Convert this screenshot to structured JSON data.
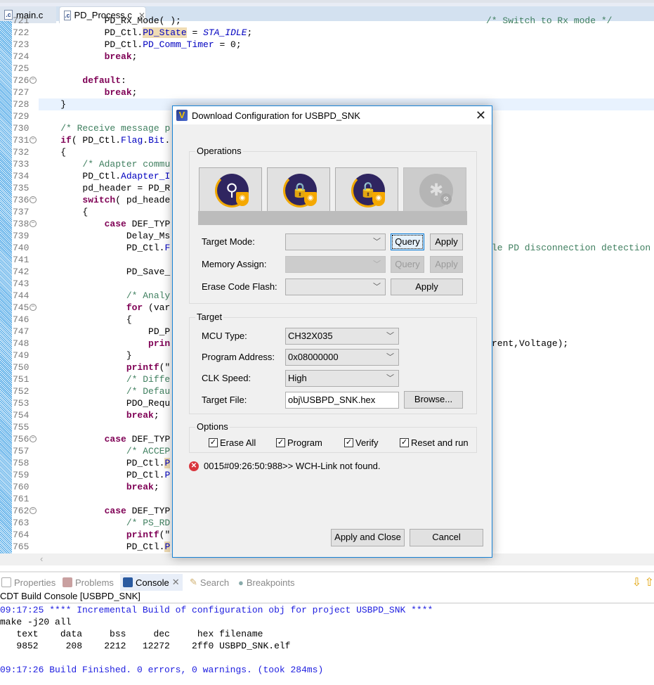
{
  "editor": {
    "tabs": [
      {
        "label": "main.c",
        "icon": "c-file-icon"
      },
      {
        "label": "PD_Process.c",
        "icon": "c-file-icon",
        "active": true
      }
    ],
    "lines": [
      {
        "n": "721",
        "seg": [
          [
            "            ",
            "p"
          ],
          [
            "PD_Rx_Mode( );",
            "p"
          ]
        ],
        "right": "/* Switch to Rx mode */"
      },
      {
        "n": "722",
        "seg": [
          [
            "            PD_Ctl.",
            "p"
          ],
          [
            "PD_State",
            "fm"
          ],
          [
            " = ",
            "p"
          ],
          [
            "STA_IDLE",
            "i"
          ],
          [
            ";",
            "p"
          ]
        ]
      },
      {
        "n": "723",
        "seg": [
          [
            "            PD_Ctl.",
            "p"
          ],
          [
            "PD_Comm_Timer",
            "f"
          ],
          [
            " = 0;",
            "p"
          ]
        ]
      },
      {
        "n": "724",
        "seg": [
          [
            "            ",
            "p"
          ],
          [
            "break",
            "k"
          ],
          [
            ";",
            "p"
          ]
        ]
      },
      {
        "n": "725",
        "seg": []
      },
      {
        "n": "726",
        "fold": true,
        "seg": [
          [
            "        ",
            "p"
          ],
          [
            "default",
            "k"
          ],
          [
            ":",
            "p"
          ]
        ]
      },
      {
        "n": "727",
        "seg": [
          [
            "            ",
            "p"
          ],
          [
            "break",
            "k"
          ],
          [
            ";",
            "p"
          ]
        ]
      },
      {
        "n": "728",
        "hl": true,
        "seg": [
          [
            "    }",
            "p"
          ]
        ]
      },
      {
        "n": "729",
        "seg": []
      },
      {
        "n": "730",
        "seg": [
          [
            "    ",
            "p"
          ],
          [
            "/* Receive message p",
            "c"
          ]
        ]
      },
      {
        "n": "731",
        "fold": true,
        "seg": [
          [
            "    ",
            "p"
          ],
          [
            "if",
            "k"
          ],
          [
            "( PD_Ctl.",
            "p"
          ],
          [
            "Flag",
            "f"
          ],
          [
            ".",
            "p"
          ],
          [
            "Bit",
            "f"
          ],
          [
            ".",
            "p"
          ]
        ]
      },
      {
        "n": "732",
        "seg": [
          [
            "    {",
            "p"
          ]
        ]
      },
      {
        "n": "733",
        "seg": [
          [
            "        ",
            "p"
          ],
          [
            "/* Adapter commu",
            "c"
          ]
        ]
      },
      {
        "n": "734",
        "seg": [
          [
            "        PD_Ctl.",
            "p"
          ],
          [
            "Adapter_I",
            "f"
          ]
        ]
      },
      {
        "n": "735",
        "seg": [
          [
            "        pd_header = PD_R",
            "p"
          ]
        ]
      },
      {
        "n": "736",
        "fold": true,
        "seg": [
          [
            "        ",
            "p"
          ],
          [
            "switch",
            "k"
          ],
          [
            "( pd_heade",
            "p"
          ]
        ]
      },
      {
        "n": "737",
        "seg": [
          [
            "        {",
            "p"
          ]
        ]
      },
      {
        "n": "738",
        "fold": true,
        "seg": [
          [
            "            ",
            "p"
          ],
          [
            "case",
            "k"
          ],
          [
            " DEF_TYP",
            "p"
          ]
        ]
      },
      {
        "n": "739",
        "seg": [
          [
            "                Delay_Ms",
            "p"
          ]
        ]
      },
      {
        "n": "740",
        "seg": [
          [
            "                PD_Ctl.",
            "p"
          ],
          [
            "F",
            "f"
          ]
        ],
        "right": "le PD disconnection detection"
      },
      {
        "n": "741",
        "seg": []
      },
      {
        "n": "742",
        "seg": [
          [
            "                PD_Save_",
            "p"
          ]
        ]
      },
      {
        "n": "743",
        "seg": []
      },
      {
        "n": "744",
        "seg": [
          [
            "                ",
            "p"
          ],
          [
            "/* Analy",
            "c"
          ]
        ]
      },
      {
        "n": "745",
        "fold": true,
        "seg": [
          [
            "                ",
            "p"
          ],
          [
            "for",
            "k"
          ],
          [
            " (var",
            "p"
          ]
        ]
      },
      {
        "n": "746",
        "seg": [
          [
            "                {",
            "p"
          ]
        ]
      },
      {
        "n": "747",
        "seg": [
          [
            "                    PD_P",
            "p"
          ]
        ]
      },
      {
        "n": "748",
        "seg": [
          [
            "                    ",
            "p"
          ],
          [
            "prin",
            "k"
          ]
        ],
        "right": "rent,Voltage);"
      },
      {
        "n": "749",
        "seg": [
          [
            "                }",
            "p"
          ]
        ]
      },
      {
        "n": "750",
        "seg": [
          [
            "                ",
            "p"
          ],
          [
            "printf",
            "k"
          ],
          [
            "(\"",
            "p"
          ]
        ]
      },
      {
        "n": "751",
        "seg": [
          [
            "                ",
            "p"
          ],
          [
            "/* Diffe",
            "c"
          ]
        ]
      },
      {
        "n": "752",
        "seg": [
          [
            "                ",
            "p"
          ],
          [
            "/* Defau",
            "c"
          ]
        ]
      },
      {
        "n": "753",
        "seg": [
          [
            "                PDO_Requ",
            "p"
          ]
        ]
      },
      {
        "n": "754",
        "seg": [
          [
            "                ",
            "p"
          ],
          [
            "break",
            "k"
          ],
          [
            ";",
            "p"
          ]
        ]
      },
      {
        "n": "755",
        "seg": []
      },
      {
        "n": "756",
        "fold": true,
        "seg": [
          [
            "            ",
            "p"
          ],
          [
            "case",
            "k"
          ],
          [
            " DEF_TYP",
            "p"
          ]
        ]
      },
      {
        "n": "757",
        "seg": [
          [
            "                ",
            "p"
          ],
          [
            "/* ACCEP",
            "c"
          ]
        ]
      },
      {
        "n": "758",
        "seg": [
          [
            "                PD_Ctl.",
            "p"
          ],
          [
            "P",
            "fm"
          ]
        ]
      },
      {
        "n": "759",
        "seg": [
          [
            "                PD_Ctl.",
            "p"
          ],
          [
            "P",
            "f"
          ]
        ]
      },
      {
        "n": "760",
        "seg": [
          [
            "                ",
            "p"
          ],
          [
            "break",
            "k"
          ],
          [
            ";",
            "p"
          ]
        ]
      },
      {
        "n": "761",
        "seg": []
      },
      {
        "n": "762",
        "fold": true,
        "seg": [
          [
            "            ",
            "p"
          ],
          [
            "case",
            "k"
          ],
          [
            " DEF_TYP",
            "p"
          ]
        ]
      },
      {
        "n": "763",
        "seg": [
          [
            "                ",
            "p"
          ],
          [
            "/* PS_RD",
            "c"
          ]
        ]
      },
      {
        "n": "764",
        "seg": [
          [
            "                ",
            "p"
          ],
          [
            "printf",
            "k"
          ],
          [
            "(\"",
            "p"
          ]
        ]
      },
      {
        "n": "765",
        "seg": [
          [
            "                PD_Ctl.",
            "p"
          ],
          [
            "P",
            "fm"
          ]
        ]
      }
    ]
  },
  "dialog": {
    "title": "Download Configuration for USBPD_SNK",
    "operations": {
      "label": "Operations",
      "buttons": [
        {
          "name": "query-button",
          "icon": "magnifier-shield-icon",
          "glyph": "⚲",
          "enabled": true
        },
        {
          "name": "protect-button",
          "icon": "lock-check-shield-icon",
          "glyph": "🔒",
          "enabled": true
        },
        {
          "name": "unprotect-button",
          "icon": "unlock-shield-icon",
          "glyph": "🔓",
          "enabled": true
        },
        {
          "name": "debug-disable-button",
          "icon": "bug-disabled-icon",
          "glyph": "✱",
          "enabled": false
        }
      ],
      "progress": 0,
      "target_mode_label": "Target Mode:",
      "target_mode_value": "",
      "memory_assign_label": "Memory Assign:",
      "memory_assign_value": "",
      "erase_label": "Erase Code Flash:",
      "erase_value": "",
      "query": "Query",
      "apply": "Apply"
    },
    "target": {
      "label": "Target",
      "mcu_label": "MCU Type:",
      "mcu_value": "CH32X035",
      "addr_label": "Program Address:",
      "addr_value": "0x08000000",
      "clk_label": "CLK Speed:",
      "clk_value": "High",
      "file_label": "Target File:",
      "file_value": "obj\\USBPD_SNK.hex",
      "browse": "Browse..."
    },
    "options": {
      "label": "Options",
      "items": [
        {
          "label": "Erase All",
          "checked": true
        },
        {
          "label": "Program",
          "checked": true
        },
        {
          "label": "Verify",
          "checked": true
        },
        {
          "label": "Reset and run",
          "checked": true
        }
      ]
    },
    "status": "0015#09:26:50:988>> WCH-Link not found.",
    "apply_close": "Apply and Close",
    "cancel": "Cancel"
  },
  "views": {
    "tabs": [
      {
        "label": "Properties",
        "icon": "properties-icon"
      },
      {
        "label": "Problems",
        "icon": "problems-icon"
      },
      {
        "label": "Console",
        "icon": "console-icon",
        "active": true
      },
      {
        "label": "Search",
        "icon": "search-icon"
      },
      {
        "label": "Breakpoints",
        "icon": "breakpoints-icon"
      }
    ],
    "console_title": "CDT Build Console [USBPD_SNK]",
    "console_lines": [
      "09:17:25 **** Incremental Build of configuration obj for project USBPD_SNK ****",
      "make -j20 all",
      "   text\t   data\t    bss\t    dec\t    hex\tfilename",
      "   9852\t    208\t   2212\t  12272\t   2ff0\tUSBPD_SNK.elf",
      "",
      "09:17:26 Build Finished. 0 errors, 0 warnings. (took 284ms)"
    ]
  },
  "colors": {
    "accent": "#1883d7",
    "keyword": "#7f0055",
    "comment": "#3f7f5f",
    "field": "#0000c0",
    "console_info": "#2020e0",
    "error": "#d9363e"
  }
}
